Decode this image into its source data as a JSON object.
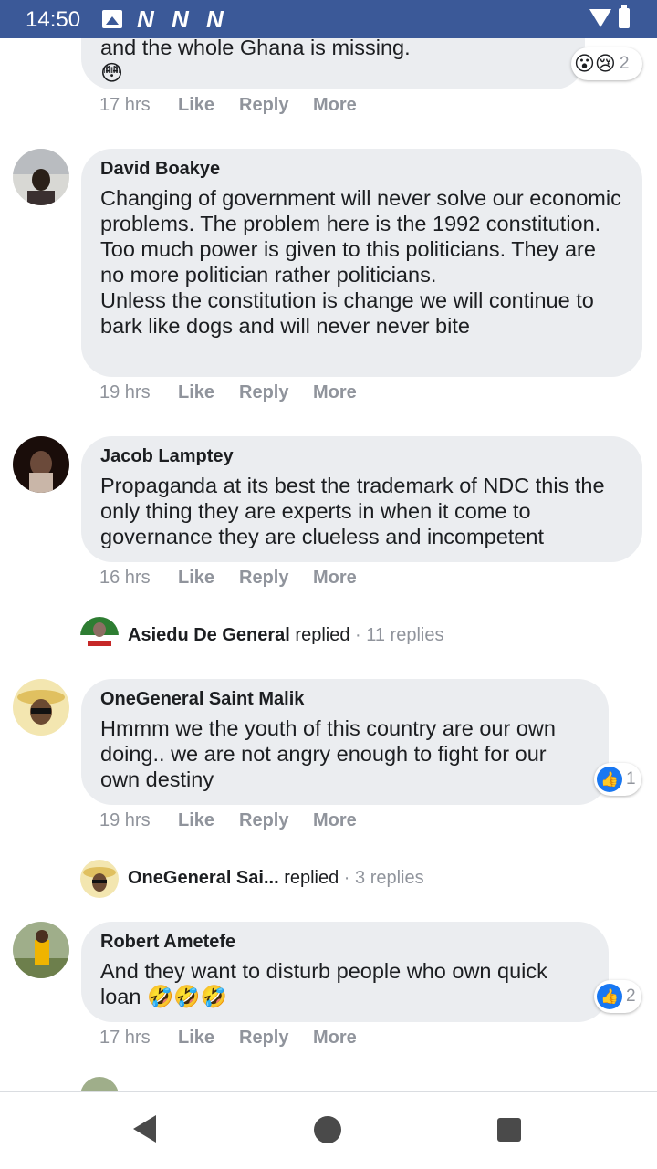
{
  "status_bar": {
    "time": "14:50",
    "notif_letter": "N"
  },
  "colors": {
    "accent": "#3b5998",
    "bubble": "#ebedf0",
    "like_blue": "#1877f2",
    "meta_gray": "#90949c"
  },
  "top_partial": {
    "text_line": "and the whole Ghana is missing.",
    "emoji": "😳",
    "reaction_emojis": "😮😢",
    "reaction_count": "2",
    "time": "17 hrs"
  },
  "actions": {
    "like": "Like",
    "reply": "Reply",
    "more": "More"
  },
  "comments": [
    {
      "author": "David Boakye",
      "text": "Changing of government will never solve our economic problems. The problem here is the 1992 constitution. Too much power is given to this politicians. They are no more politician rather politicians.\nUnless the constitution is change we will continue to bark like dogs and will never never bite",
      "time": "19 hrs"
    },
    {
      "author": "Jacob Lamptey",
      "text": "Propaganda at its best the trademark of NDC this the only thing they are experts in when it come to governance they are clueless and incompetent",
      "time": "16 hrs",
      "replied": {
        "name": "Asiedu De General",
        "verb": "replied",
        "count": "· 11 replies"
      }
    },
    {
      "author": "OneGeneral Saint Malik",
      "text": "Hmmm we the youth of this country are our own doing.. we are not angry enough to fight for our own destiny",
      "time": "19 hrs",
      "reaction_count": "1",
      "replied": {
        "name": "OneGeneral Sai...",
        "verb": "replied",
        "count": "· 3 replies"
      }
    },
    {
      "author": "Robert Ametefe",
      "text": "And they want to disturb people who own quick loan 🤣🤣🤣",
      "time": "17 hrs",
      "reaction_count": "2"
    }
  ]
}
